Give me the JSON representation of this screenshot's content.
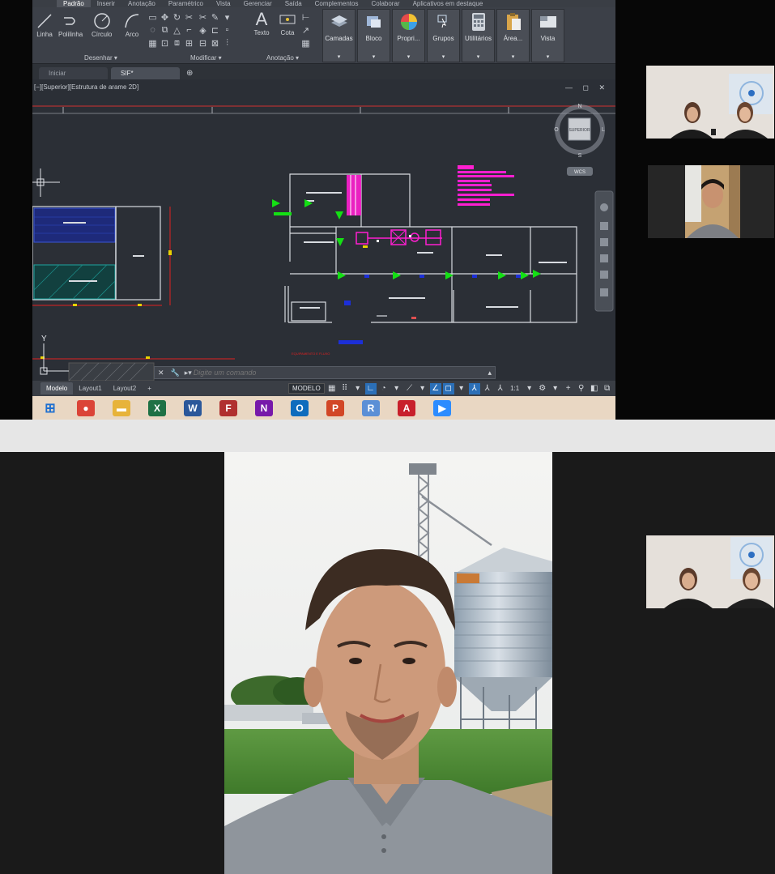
{
  "ribbon": {
    "tabs": [
      "Padrão",
      "Inserir",
      "Anotação",
      "Paramétrico",
      "Vista",
      "Gerenciar",
      "Saída",
      "Complementos",
      "Colaborar",
      "Aplicativos em destaque"
    ],
    "draw_tools": [
      "Linha",
      "Polilinha",
      "Círculo",
      "Arco"
    ],
    "annotation_tools": [
      "Texto",
      "Cota"
    ],
    "panel_labels": {
      "draw": "Desenhar ▾",
      "modify": "Modificar ▾",
      "annotation": "Anotação ▾"
    },
    "big_buttons": [
      "Camadas",
      "Bloco",
      "Propri...",
      "Grupos",
      "Utilitários",
      "Área...",
      "Vista"
    ]
  },
  "file_tabs": [
    "Iniciar",
    "SIF*"
  ],
  "viewport": {
    "label": "[−][Superior][Estrutura de arame 2D]",
    "controls": "— ◻ ✕"
  },
  "viewcube": {
    "face": "SUPERIOR",
    "n": "N",
    "s": "S",
    "e": "L",
    "w": "O",
    "wcs": "WCS"
  },
  "drawing_note": "EQUIPAMENTO E FLUXO",
  "axis_label": "Y",
  "command": {
    "placeholder": "Digite um comando",
    "close": "✕",
    "settings": "🔧",
    "prompt": "▸▾"
  },
  "status": {
    "tabs": [
      "Modelo",
      "Layout1",
      "Layout2"
    ],
    "plus": "+",
    "model": "MODELO",
    "scale": "1:1"
  },
  "taskbar": {
    "items": [
      {
        "name": "windows-start-icon",
        "glyph": "⊞",
        "color": "#1e6fd0"
      },
      {
        "name": "chrome-icon",
        "glyph": "●",
        "color": "#db4437"
      },
      {
        "name": "file-explorer-icon",
        "glyph": "▬",
        "color": "#e7b33a"
      },
      {
        "name": "excel-icon",
        "glyph": "X",
        "color": "#1e7145"
      },
      {
        "name": "word-icon",
        "glyph": "W",
        "color": "#2b579a"
      },
      {
        "name": "foxit-icon",
        "glyph": "F",
        "color": "#b0302f"
      },
      {
        "name": "onenote-icon",
        "glyph": "N",
        "color": "#7719aa"
      },
      {
        "name": "outlook-icon",
        "glyph": "O",
        "color": "#0f6cbd"
      },
      {
        "name": "powerpoint-icon",
        "glyph": "P",
        "color": "#d24726"
      },
      {
        "name": "r-icon",
        "glyph": "R",
        "color": "#5b8fd6"
      },
      {
        "name": "autocad-icon",
        "glyph": "A",
        "color": "#c8202b"
      },
      {
        "name": "zoom-icon",
        "glyph": "▶",
        "color": "#2d8cff"
      }
    ]
  },
  "colors": {
    "magenta": "#ff1fd0",
    "green": "#14e014",
    "red": "#e02020",
    "blue": "#1c2fd8",
    "white": "#d8dbe0"
  }
}
